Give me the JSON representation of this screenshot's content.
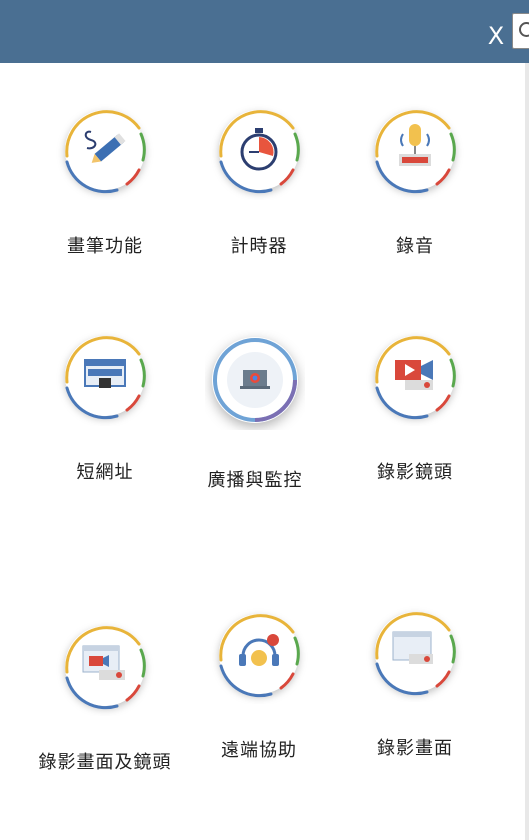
{
  "header": {
    "close_label": "X"
  },
  "colors": {
    "header": "#4a6f92",
    "ring_yellow": "#e8b43a",
    "ring_green": "#5aa84e",
    "ring_red": "#d9483b",
    "ring_blue": "#4a78b8"
  },
  "tools": [
    {
      "label": "畫筆功能",
      "icon": "pen-icon"
    },
    {
      "label": "計時器",
      "icon": "stopwatch-icon"
    },
    {
      "label": "錄音",
      "icon": "microphone-icon"
    },
    {
      "label": "短網址",
      "icon": "short-url-icon"
    },
    {
      "label": "廣播與監控",
      "icon": "broadcast-monitor-icon"
    },
    {
      "label": "錄影鏡頭",
      "icon": "video-camera-icon"
    },
    {
      "label": "錄影畫面及鏡頭",
      "icon": "screen-camera-record-icon"
    },
    {
      "label": "遠端協助",
      "icon": "remote-support-icon"
    },
    {
      "label": "錄影畫面",
      "icon": "screen-record-icon"
    }
  ]
}
